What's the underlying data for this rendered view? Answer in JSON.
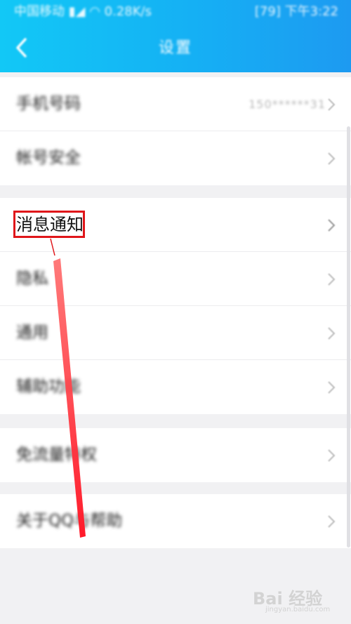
{
  "status_bar": {
    "carrier": "中国移动",
    "net_speed": "0.28K/s",
    "right_text": "79",
    "time": "下午3:22"
  },
  "header": {
    "title": "设置",
    "back_icon": "chevron-left-icon"
  },
  "groups": [
    {
      "items": [
        {
          "label": "手机号码",
          "value": "150******31"
        },
        {
          "label": "帐号安全",
          "value": ""
        }
      ]
    },
    {
      "items": [
        {
          "label": "消息通知",
          "value": ""
        },
        {
          "label": "隐私",
          "value": ""
        },
        {
          "label": "通用",
          "value": ""
        },
        {
          "label": "辅助功能",
          "value": ""
        }
      ]
    },
    {
      "items": [
        {
          "label": "免流量特权",
          "value": ""
        }
      ]
    },
    {
      "items": [
        {
          "label": "关于QQ与帮助",
          "value": ""
        }
      ]
    }
  ],
  "annotation": {
    "highlighted_item": "消息通知",
    "color": "#e0161a"
  },
  "watermark": {
    "main": "Bai 经验",
    "sub": "jingyan.baidu.com"
  },
  "colors": {
    "header_start": "#12c8f6",
    "header_end": "#1d9af1",
    "background": "#f1f1f3"
  }
}
